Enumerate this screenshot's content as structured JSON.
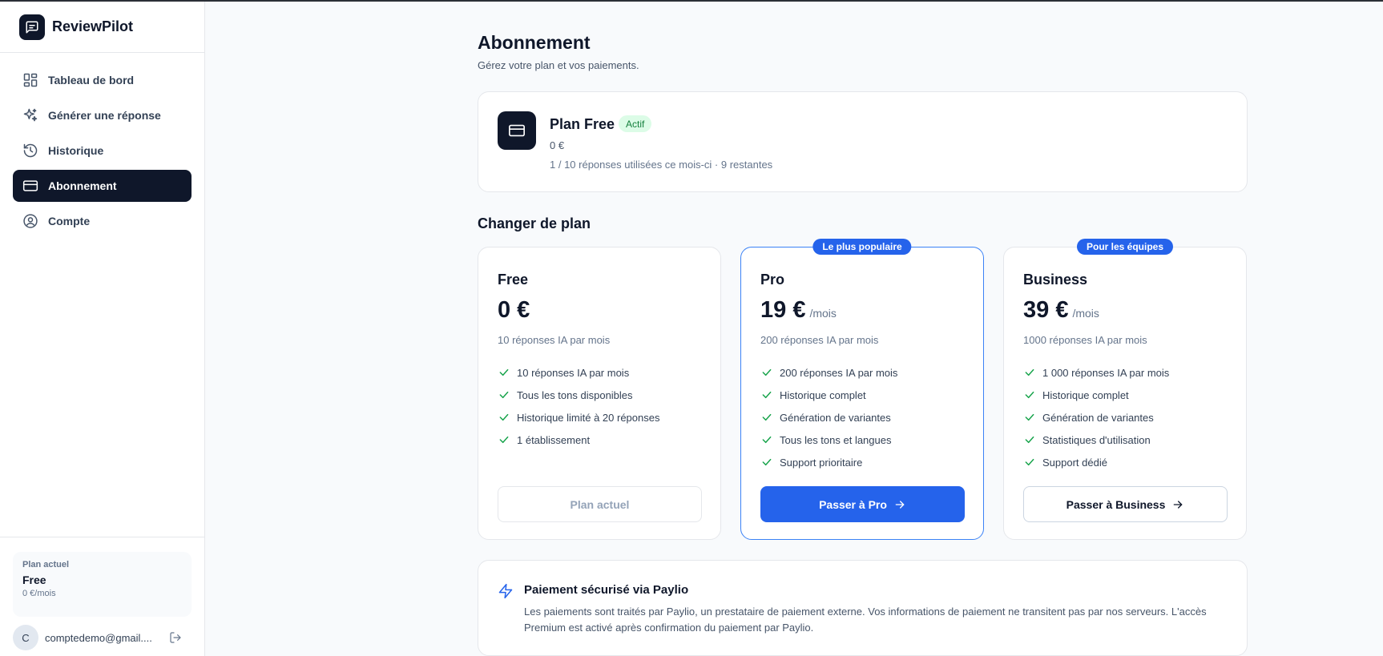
{
  "app": {
    "name": "ReviewPilot"
  },
  "sidebar": {
    "items": [
      {
        "label": "Tableau de bord",
        "icon": "dashboard-icon"
      },
      {
        "label": "Générer une réponse",
        "icon": "sparkles-icon"
      },
      {
        "label": "Historique",
        "icon": "history-icon"
      },
      {
        "label": "Abonnement",
        "icon": "credit-card-icon",
        "active": true
      },
      {
        "label": "Compte",
        "icon": "user-circle-icon"
      }
    ],
    "plan_label": "Plan actuel",
    "plan_name": "Free",
    "plan_price": "0 €/mois",
    "user_initial": "C",
    "user_email": "comptedemo@gmail....",
    "logout_icon": "logout-icon"
  },
  "page": {
    "title": "Abonnement",
    "subtitle": "Gérez votre plan et vos paiements."
  },
  "current_plan": {
    "title": "Plan Free",
    "status": "Actif",
    "price": "0 €",
    "usage": "1 / 10 réponses utilisées ce mois-ci · 9 restantes"
  },
  "change_plan": {
    "title": "Changer de plan",
    "plans": [
      {
        "name": "Free",
        "price": "0 €",
        "period": "",
        "description": "10 réponses IA par mois",
        "features": [
          "10 réponses IA par mois",
          "Tous les tons disponibles",
          "Historique limité à 20 réponses",
          "1 établissement"
        ],
        "button": "Plan actuel"
      },
      {
        "name": "Pro",
        "tag": "Le plus populaire",
        "price": "19 €",
        "period": "/mois",
        "description": "200 réponses IA par mois",
        "features": [
          "200 réponses IA par mois",
          "Historique complet",
          "Génération de variantes",
          "Tous les tons et langues",
          "Support prioritaire"
        ],
        "button": "Passer à Pro"
      },
      {
        "name": "Business",
        "tag": "Pour les équipes",
        "price": "39 €",
        "period": "/mois",
        "description": "1000 réponses IA par mois",
        "features": [
          "1 000 réponses IA par mois",
          "Historique complet",
          "Génération de variantes",
          "Statistiques d'utilisation",
          "Support dédié"
        ],
        "button": "Passer à Business"
      }
    ]
  },
  "secure": {
    "title": "Paiement sécurisé via Paylio",
    "text": "Les paiements sont traités par Paylio, un prestataire de paiement externe. Vos informations de paiement ne transitent pas par nos serveurs. L'accès Premium est activé après confirmation du paiement par Paylio."
  },
  "colors": {
    "primary": "#2563eb",
    "dark": "#0f172a",
    "success_bg": "#dcfce7",
    "success_text": "#15803d",
    "check": "#16a34a"
  }
}
